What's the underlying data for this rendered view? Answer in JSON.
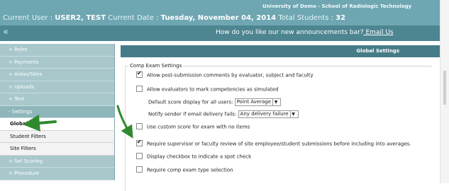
{
  "header": {
    "school": "University of Demo - School of Radiologic Technology",
    "current_user_label": "Current User : ",
    "current_user_value": "USER2, TEST",
    "current_date_label": " Current Date : ",
    "current_date_value": "Tuesday, November 04, 2014",
    "total_students_label": " Total Students : ",
    "total_students_value": "32"
  },
  "announcement": {
    "collapse_glyph": "«",
    "message": "How do you like our new announcements bar?",
    "email_link": " Email Us"
  },
  "sidebar": {
    "items": [
      {
        "label": "+ Roles"
      },
      {
        "label": "+ Payments"
      },
      {
        "label": "+ Areas/Sites"
      },
      {
        "label": "+ Uploads"
      },
      {
        "label": "+ Text"
      },
      {
        "label": "- Settings"
      },
      {
        "label": "Global"
      },
      {
        "label": "Student Filters"
      },
      {
        "label": "Site Filters"
      },
      {
        "label": "+ Set Scoring"
      },
      {
        "label": "+ Procedure"
      }
    ]
  },
  "panel": {
    "title": "Global Settings",
    "group_legend": "Comp Exam Settings",
    "options": {
      "allow_post_submission": {
        "label": "Allow post-submission comments by evaluator, subject and faculty",
        "checked": true
      },
      "allow_simulated": {
        "label": "Allow evaluators to mark competencies as simulated",
        "checked": false
      },
      "default_score_label": "Default score display for all users:",
      "default_score_value": "Point Average",
      "notify_label": "Notify sender if email delivery fails:",
      "notify_value": "Any delivery failure",
      "custom_score": {
        "label": "Use custom score for exam with no items",
        "checked": false
      },
      "require_review": {
        "label": "Require supervisor or faculty review of site employee/student submissions before including into averages.",
        "checked": true
      },
      "spot_check": {
        "label": "Display checkbox to indicate a spot check",
        "checked": false
      },
      "require_type": {
        "label": "Require comp exam type selection",
        "checked": false
      }
    }
  },
  "colors": {
    "header_bg": "#6ea6b1",
    "announcement_bg": "#4d8591",
    "panel_title_bg": "#467c87",
    "arrow": "#2f8a2f"
  }
}
